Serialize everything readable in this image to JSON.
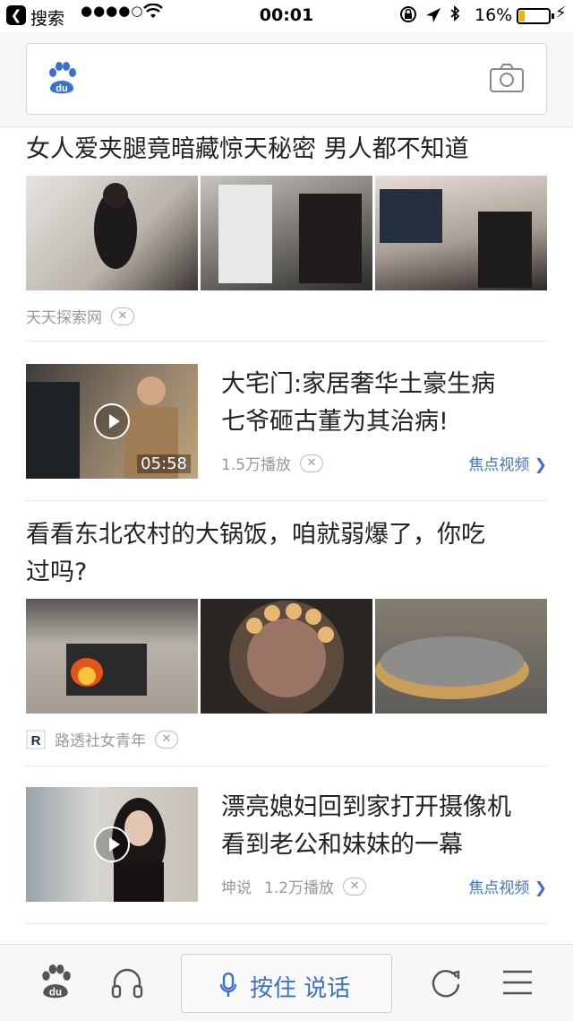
{
  "status_bar": {
    "back_app": "搜索",
    "time": "00:01",
    "battery_pct": "16%"
  },
  "feed": {
    "items": [
      {
        "title": "女人爱夹腿竟暗藏惊天秘密 男人都不知道",
        "source": "天天探索网"
      },
      {
        "title_line1": "大宅门:家居奢华土豪生病",
        "title_line2": "七爷砸古董为其治病!",
        "duration": "05:58",
        "plays": "1.5万播放",
        "source_link": "焦点视频"
      },
      {
        "title_line1": "看看东北农村的大锅饭，咱就弱爆了，你吃",
        "title_line2": "过吗?",
        "source": "路透社女青年"
      },
      {
        "title_line1": "漂亮媳妇回到家打开摄像机",
        "title_line2": "看到老公和妹妹的一幕",
        "author": "坤说",
        "plays": "1.2万播放",
        "source_link": "焦点视频"
      }
    ],
    "dismiss_glyph": "✕"
  },
  "toolbar": {
    "voice_label": "按住 说话"
  },
  "colors": {
    "accent": "#3a72d0",
    "battery": "#f3b400"
  },
  "icons": [
    "back-icon",
    "wifi-icon",
    "lock-icon",
    "location-icon",
    "bluetooth-icon",
    "baidu-logo-icon",
    "camera-icon",
    "play-icon",
    "headphones-icon",
    "mic-icon",
    "refresh-icon",
    "menu-icon"
  ]
}
